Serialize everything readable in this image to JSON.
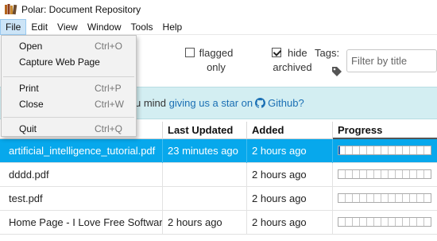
{
  "window": {
    "title": "Polar: Document Repository"
  },
  "menubar": [
    "File",
    "Edit",
    "View",
    "Window",
    "Tools",
    "Help"
  ],
  "file_menu": {
    "groups": [
      [
        {
          "label": "Open",
          "shortcut": "Ctrl+O"
        },
        {
          "label": "Capture Web Page",
          "shortcut": ""
        }
      ],
      [
        {
          "label": "Print",
          "shortcut": "Ctrl+P"
        },
        {
          "label": "Close",
          "shortcut": "Ctrl+W"
        }
      ],
      [
        {
          "label": "Quit",
          "shortcut": "Ctrl+Q"
        }
      ]
    ]
  },
  "toolbar": {
    "flagged": {
      "line1": "flagged",
      "line2": "only",
      "checked": false
    },
    "archived": {
      "line1": "hide",
      "line2": "archived",
      "checked": true
    },
    "tags_label": "Tags:",
    "filter_placeholder": "Filter by title"
  },
  "banner": {
    "prefix": "u mind ",
    "link_text": "giving us a star on",
    "github_text": "Github?"
  },
  "table": {
    "columns": [
      "Title",
      "Last Updated",
      "Added",
      "Progress"
    ],
    "rows": [
      {
        "title": "artificial_intelligence_tutorial.pdf",
        "last_updated": "23 minutes ago",
        "added": "2 hours ago",
        "progress": 0.02,
        "selected": true
      },
      {
        "title": "dddd.pdf",
        "last_updated": "",
        "added": "2 hours ago",
        "progress": 0,
        "selected": false
      },
      {
        "title": "test.pdf",
        "last_updated": "",
        "added": "2 hours ago",
        "progress": 0,
        "selected": false
      },
      {
        "title": "Home Page - I Love Free Software",
        "last_updated": "2 hours ago",
        "added": "2 hours ago",
        "progress": 0,
        "selected": false
      }
    ]
  },
  "colors": {
    "selection": "#07a8ec",
    "banner_bg": "#d3eef2",
    "link": "#1a6fb4",
    "progress_fill": "#1565c0"
  },
  "icons": {
    "app": "books-icon",
    "tag": "tag-icon",
    "github": "github-icon"
  }
}
